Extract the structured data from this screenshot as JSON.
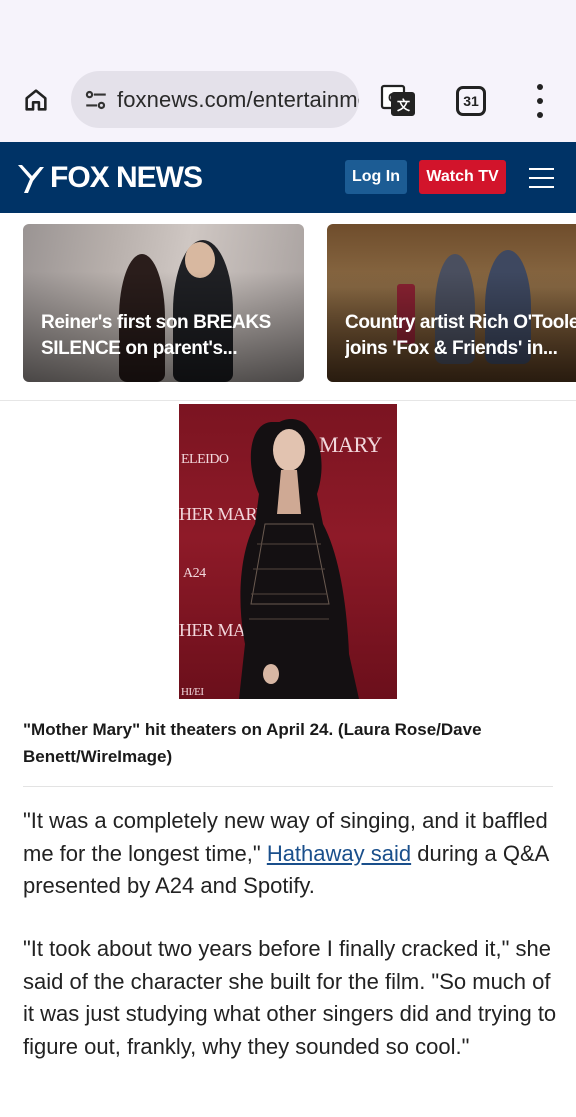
{
  "browser": {
    "url": "foxnews.com/entertainme",
    "tab_count": "31",
    "icons": [
      "home-icon",
      "tune-icon",
      "translate-icon",
      "tabs-icon",
      "more-vert-icon"
    ]
  },
  "header": {
    "logo_text": "FOX NEWS",
    "login_label": "Log In",
    "watch_label": "Watch TV",
    "colors": {
      "bar": "#003366",
      "login": "#1c5c94",
      "watch": "#d2142b"
    }
  },
  "stories": [
    {
      "line1": "Reiner's first son BREAKS",
      "line2": "SILENCE on parent's..."
    },
    {
      "line1": "Country artist Rich O'Toole",
      "line2": "joins 'Fox & Friends' in..."
    }
  ],
  "photo": {
    "wall_words": [
      "MARY",
      "ELEIDO",
      "HER MARY",
      "A24",
      "HER MA",
      "HI/EI"
    ]
  },
  "caption": "\"Mother Mary\" hit theaters on April 24. (Laura Rose/Dave Benett/WireImage)",
  "article": {
    "p1_before": "\"It was a completely new way of singing, and it baffled me for the longest time,\" ",
    "p1_link": "Hathaway said",
    "p1_after": " during a Q&A presented by A24 and Spotify.",
    "p2": "\"It took about two years before I finally cracked it,\" she said of the character she built for the film. \"So much of it was just studying what other singers did and trying to figure out, frankly, why they sounded so cool.\""
  }
}
